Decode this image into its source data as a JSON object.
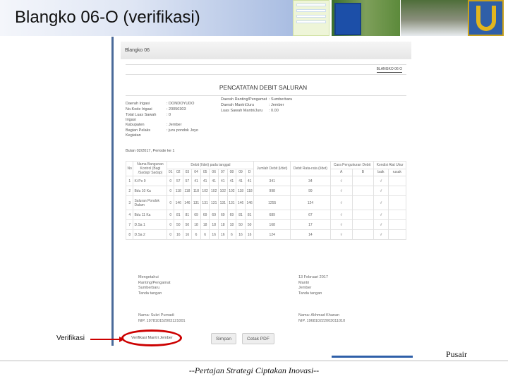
{
  "slide": {
    "title": "Blangko 06-O (verifikasi)",
    "annotation": "Verifikasi",
    "brand": "Pusair",
    "footer": "--Pertajan Strategi Ciptakan Inovasi--"
  },
  "app": {
    "panel_title": "Blangko 06",
    "tab": "BLANGKO 06 O",
    "page_title": "PENCATATAN DEBIT SALURAN",
    "info_left": [
      {
        "label": "Daerah Irigasi",
        "value": ": DONDOYUDO"
      },
      {
        "label": "No.Kode Irigasi",
        "value": ": 20050303"
      },
      {
        "label": "Total Luas Sawah Irigasi",
        "value": ": 0"
      },
      {
        "label": "Kabupaten",
        "value": ": Jember"
      },
      {
        "label": "Bagian Pelaks Kegiatan",
        "value": ": juru pondok Joyo"
      }
    ],
    "info_right": [
      {
        "label": "Daerah Ranting/Pengamat",
        "value": ": Sumberbaru"
      },
      {
        "label": "Daerah Mantri/Juru",
        "value": ": Jember"
      },
      {
        "label": "Luas Sawah Mantri/Juru",
        "value": ": 0.00"
      }
    ],
    "period": "Bulan 02/2017, Periode ke 1",
    "table": {
      "h_no": "No",
      "h_name": "Nama Bangunan Kontrol (Bagi /Sadap/ Sadap)",
      "h_debit": "Debit (l/det) pada tanggal",
      "days": [
        "01",
        "02",
        "03",
        "04",
        "05",
        "06",
        "07",
        "08",
        "09",
        "D"
      ],
      "h_total": "Jumlah Debit (l/det)",
      "h_avg": "Debit Rata-rata (l/det)",
      "h_method": "Cara Pengukuran Debit",
      "h_a": "A",
      "h_b": "B",
      "h_cond": "Kondisi Alat Ukur",
      "h_good": "baik",
      "h_bad": "rusak",
      "rows": [
        {
          "no": "1",
          "name": "Ki Po 9",
          "v": [
            "0",
            "57",
            "57",
            "41",
            "41",
            "41",
            "41",
            "41",
            "41",
            "41"
          ],
          "total": "341",
          "avg": "34",
          "a": "√",
          "b": "",
          "good": "√",
          "bad": ""
        },
        {
          "no": "2",
          "name": "Bdu 10 Ka",
          "v": [
            "0",
            "118",
            "118",
            "118",
            "102",
            "102",
            "102",
            "102",
            "118",
            "118"
          ],
          "total": "998",
          "avg": "99",
          "a": "√",
          "b": "",
          "good": "√",
          "bad": ""
        },
        {
          "no": "3",
          "name": "Saluran Pondok Dalam",
          "v": [
            "0",
            "146",
            "146",
            "131",
            "131",
            "131",
            "131",
            "131",
            "146",
            "146"
          ],
          "total": "1255",
          "avg": "124",
          "a": "√",
          "b": "",
          "good": "√",
          "bad": ""
        },
        {
          "no": "4",
          "name": "Bdu 11 Ka",
          "v": [
            "0",
            "81",
            "81",
            "69",
            "69",
            "69",
            "69",
            "69",
            "81",
            "81"
          ],
          "total": "689",
          "avg": "67",
          "a": "√",
          "b": "",
          "good": "√",
          "bad": ""
        },
        {
          "no": "7",
          "name": "D.Sa 1",
          "v": [
            "0",
            "50",
            "50",
            "18",
            "18",
            "18",
            "18",
            "18",
            "50",
            "50"
          ],
          "total": "168",
          "avg": "17",
          "a": "√",
          "b": "",
          "good": "√",
          "bad": ""
        },
        {
          "no": "8",
          "name": "D.Sa 2",
          "v": [
            "0",
            "16",
            "16",
            "6",
            "6",
            "16",
            "16",
            "6",
            "16",
            "16"
          ],
          "total": "124",
          "avg": "14",
          "a": "√",
          "b": "",
          "good": "√",
          "bad": ""
        }
      ]
    },
    "sign_left": [
      "Mengetahui",
      "Ranting/Pengamat",
      "Sumberbaru",
      "Tanda tangan"
    ],
    "sign_left_name": "Nama: Sukri Purnadi",
    "sign_left_nip": "NIP. 197810152003121001",
    "sign_right": [
      "13 Februari 2017",
      "Mantri",
      "Jember",
      "Tanda tangan"
    ],
    "sign_right_name": "Nama: Akhmad Khanan",
    "sign_right_nip": "NIP. 196810222003011010",
    "verify_link": "Verifikasi Mantri Jember",
    "save": "Simpan",
    "pdf": "Cetak PDF"
  }
}
